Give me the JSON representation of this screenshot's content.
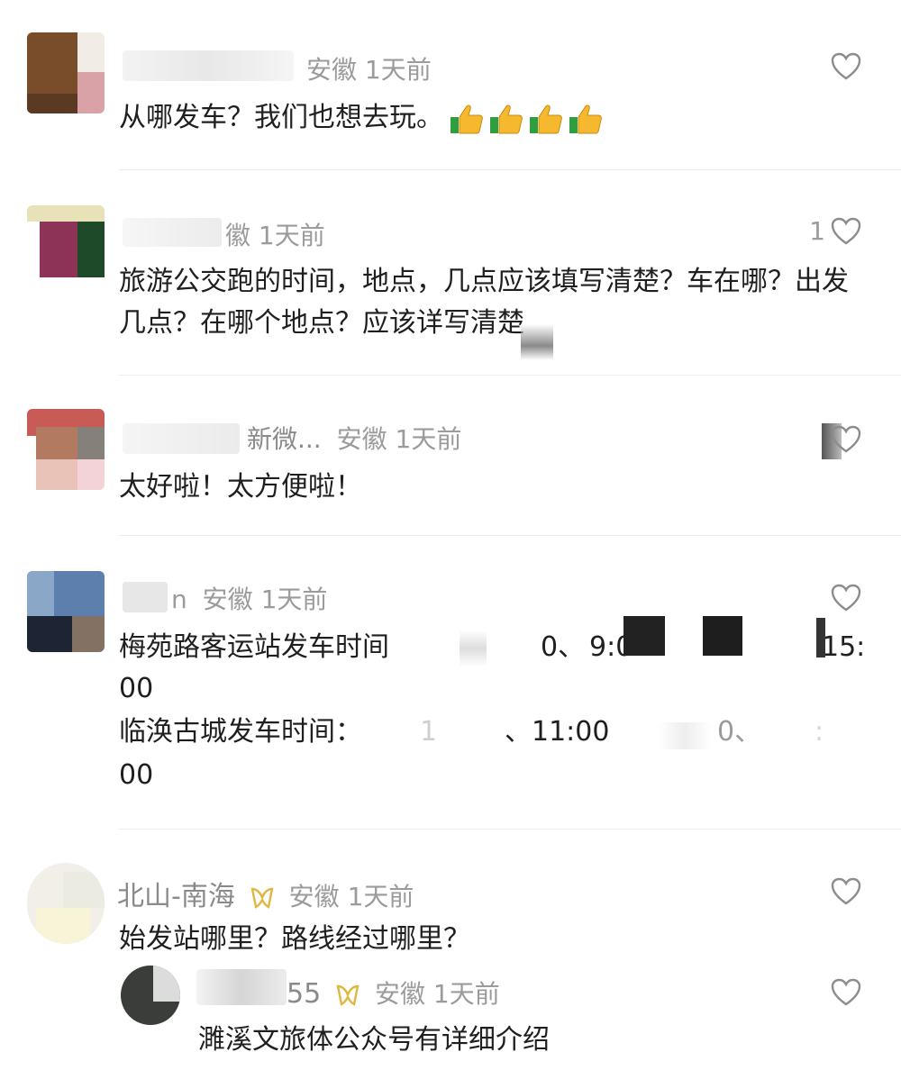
{
  "comments": [
    {
      "name": "",
      "location": "安徽",
      "time": "1天前",
      "text": "从哪发车？我们也想去玩。",
      "emoji": "thumbs-up-icon",
      "emoji_count": 4,
      "likes": ""
    },
    {
      "name": "徽",
      "location": "",
      "time": "1天前",
      "text": "旅游公交跑的时间，地点，几点应该填写清楚？车在哪？出发几点？在哪个地点？应该详写清楚",
      "likes": "1"
    },
    {
      "name": "新微...",
      "location": "安徽",
      "time": "1天前",
      "text": "太好啦！太方便啦！",
      "likes": ""
    },
    {
      "name": "n",
      "location": "安徽",
      "time": "1天前",
      "text_line1": "梅苑路客运站发车时间",
      "text_fragments_line1": [
        "0、",
        "9:0",
        "15:"
      ],
      "text_line2": "00",
      "text_line3": "临涣古城发车时间：",
      "text_fragments_line3": [
        "1",
        "、11:00",
        "0、",
        ":"
      ],
      "text_line4": "00",
      "likes": ""
    },
    {
      "name": "北山-南海",
      "badge": "fan-badge-icon",
      "location": "安徽",
      "time": "1天前",
      "text": "始发站哪里？路线经过哪里？",
      "likes": ""
    }
  ],
  "reply": {
    "name": "55",
    "badge": "fan-badge-icon",
    "location": "安徽",
    "time": "1天前",
    "text": "濉溪文旅体公众号有详细介绍",
    "likes": ""
  },
  "colors": {
    "text": "#1f1f1f",
    "meta": "#9b9b9b",
    "divider": "#ececec",
    "badge": "#e0b640",
    "thumb_yellow": "#f5b82e",
    "thumb_green": "#2e9e3e"
  }
}
